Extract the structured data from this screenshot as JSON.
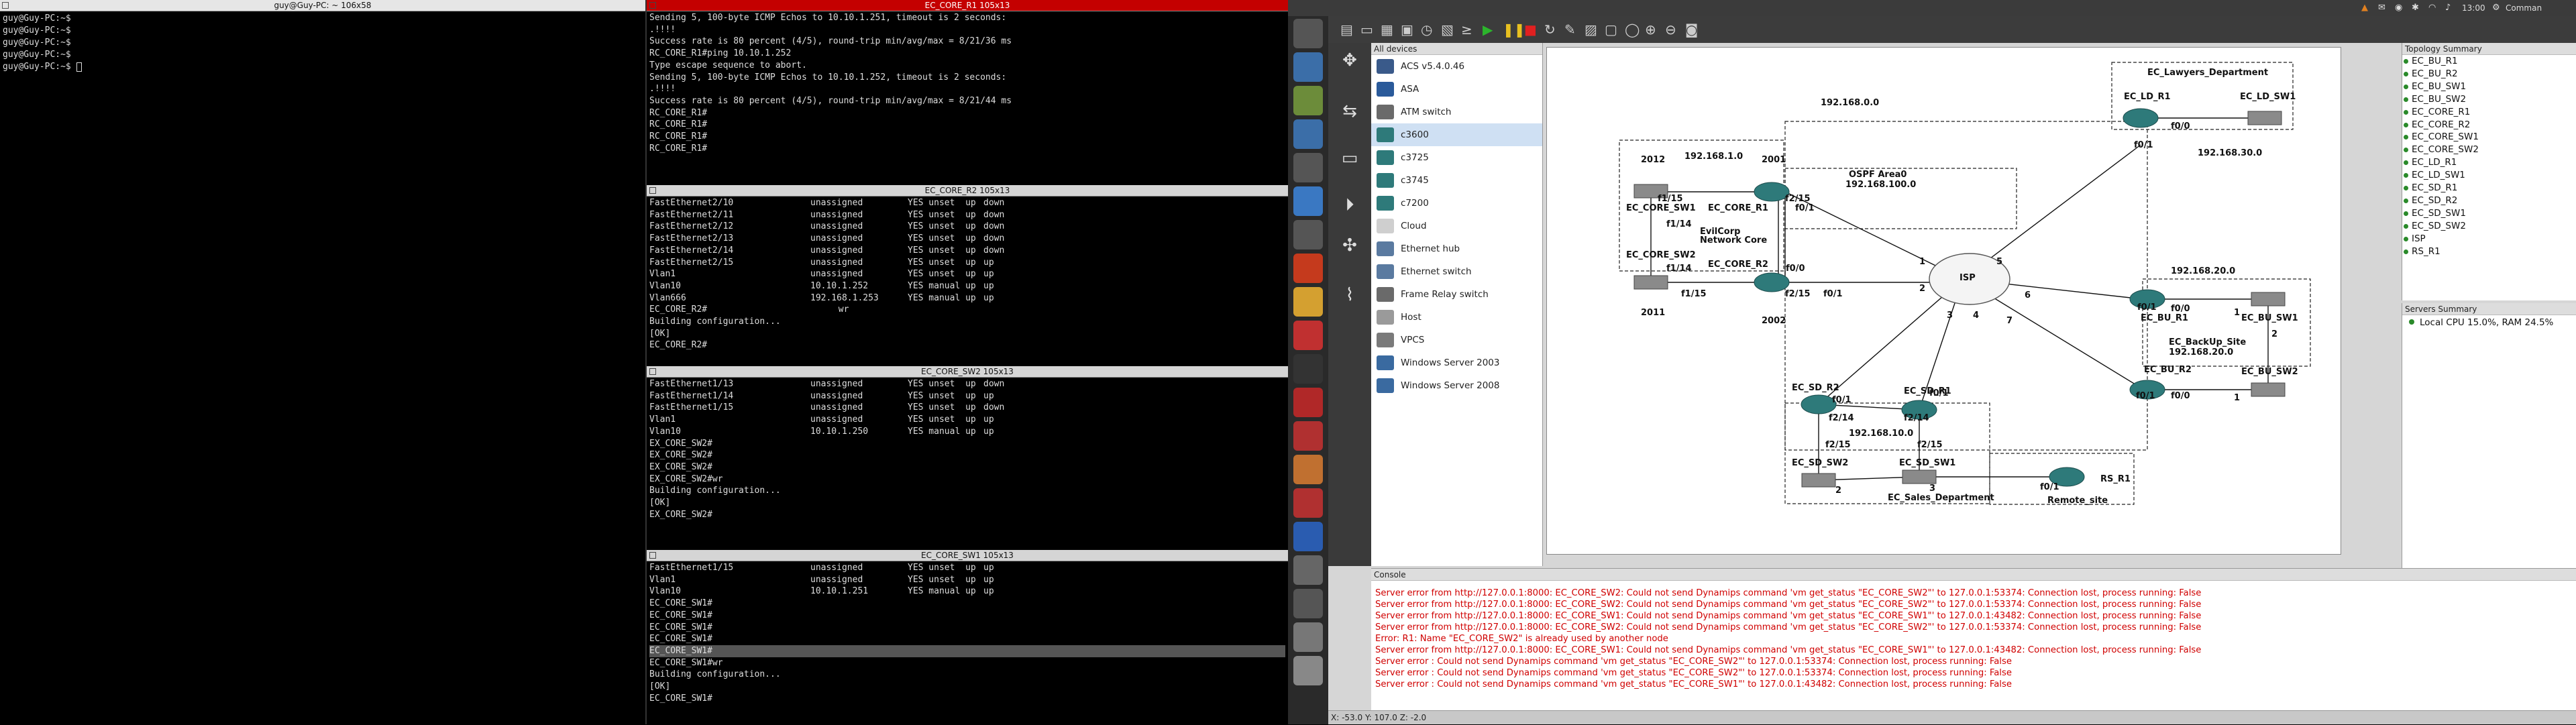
{
  "left_terminal": {
    "title": "guy@Guy-PC: ~ 106x58",
    "lines": [
      "guy@Guy-PC:~$",
      "guy@Guy-PC:~$",
      "guy@Guy-PC:~$",
      "guy@Guy-PC:~$",
      "guy@Guy-PC:~$",
      "guy@Guy-PC:~$ "
    ]
  },
  "term_core_r1": {
    "title": "EC_CORE_R1 105x13",
    "lines": [
      "Sending 5, 100-byte ICMP Echos to 10.10.1.251, timeout is 2 seconds:",
      ".!!!!",
      "Success rate is 80 percent (4/5), round-trip min/avg/max = 8/21/36 ms",
      "RC_CORE_R1#ping 10.10.1.252",
      "",
      "Type escape sequence to abort.",
      "Sending 5, 100-byte ICMP Echos to 10.10.1.252, timeout is 2 seconds:",
      ".!!!!",
      "Success rate is 80 percent (4/5), round-trip min/avg/max = 8/21/44 ms",
      "RC_CORE_R1#",
      "RC_CORE_R1#",
      "RC_CORE_R1#",
      "RC_CORE_R1#"
    ]
  },
  "term_core_r2": {
    "title": "EC_CORE_R2 105x13",
    "rows": [
      [
        "FastEthernet2/10",
        "unassigned",
        "YES unset  up",
        "down"
      ],
      [
        "FastEthernet2/11",
        "unassigned",
        "YES unset  up",
        "down"
      ],
      [
        "FastEthernet2/12",
        "unassigned",
        "YES unset  up",
        "down"
      ],
      [
        "FastEthernet2/13",
        "unassigned",
        "YES unset  up",
        "down"
      ],
      [
        "FastEthernet2/14",
        "unassigned",
        "YES unset  up",
        "down"
      ],
      [
        "FastEthernet2/15",
        "unassigned",
        "YES unset  up",
        "up"
      ],
      [
        "Vlan1",
        "unassigned",
        "YES unset  up",
        "up"
      ],
      [
        "Vlan10",
        "10.10.1.252",
        "YES manual up",
        "up"
      ],
      [
        "Vlan666",
        "192.168.1.253",
        "YES manual up",
        "up"
      ]
    ],
    "tail": [
      "EC_CORE_R2#                         wr",
      "Building configuration...",
      "[OK]",
      "EC_CORE_R2#"
    ]
  },
  "term_core_sw2": {
    "title": "EC_CORE_SW2 105x13",
    "rows": [
      [
        "FastEthernet1/13",
        "unassigned",
        "YES unset  up",
        "down"
      ],
      [
        "FastEthernet1/14",
        "unassigned",
        "YES unset  up",
        "up"
      ],
      [
        "FastEthernet1/15",
        "unassigned",
        "YES unset  up",
        "down"
      ],
      [
        "Vlan1",
        "unassigned",
        "YES unset  up",
        "up"
      ],
      [
        "Vlan10",
        "10.10.1.250",
        "YES manual up",
        "up"
      ]
    ],
    "tail": [
      "EX_CORE_SW2#",
      "EX_CORE_SW2#",
      "EX_CORE_SW2#",
      "EX_CORE_SW2#wr",
      "Building configuration...",
      "[OK]",
      "EX_CORE_SW2#"
    ]
  },
  "term_core_sw1": {
    "title": "EC_CORE_SW1 105x13",
    "rows": [
      [
        "FastEthernet1/15",
        "unassigned",
        "YES unset  up",
        "up"
      ],
      [
        "Vlan1",
        "unassigned",
        "YES unset  up",
        "up"
      ],
      [
        "Vlan10",
        "10.10.1.251",
        "YES manual up",
        "up"
      ]
    ],
    "tail": [
      "EC_CORE_SW1#",
      "EC_CORE_SW1#",
      "EC_CORE_SW1#",
      "EC_CORE_SW1#",
      "EC_CORE_SW1#",
      "EC_CORE_SW1#wr",
      "Building configuration...",
      "[OK]",
      "EC_CORE_SW1#"
    ]
  },
  "gns": {
    "clock": "13:00",
    "user": "Comman",
    "devices_header": "All devices",
    "devices": [
      "ACS v5.4.0.46",
      "ASA",
      "ATM switch",
      "c3600",
      "c3725",
      "c3745",
      "c7200",
      "Cloud",
      "Ethernet hub",
      "Ethernet switch",
      "Frame Relay switch",
      "Host",
      "VPCS",
      "Windows Server 2003",
      "Windows Server 2008"
    ],
    "topology_header": "Topology Summary",
    "topology": [
      "EC_BU_R1",
      "EC_BU_R2",
      "EC_BU_SW1",
      "EC_BU_SW2",
      "EC_CORE_R1",
      "EC_CORE_R2",
      "EC_CORE_SW1",
      "EC_CORE_SW2",
      "EC_LD_R1",
      "EC_LD_SW1",
      "EC_SD_R1",
      "EC_SD_R2",
      "EC_SD_SW1",
      "EC_SD_SW2",
      "ISP",
      "RS_R1"
    ],
    "servers_header": "Servers Summary",
    "server": "Local CPU 15.0%, RAM 24.5%",
    "console_header": "Console",
    "console": [
      "Server error from http://127.0.0.1:8000: EC_CORE_SW2: Could not send Dynamips command 'vm get_status \"EC_CORE_SW2\"' to 127.0.0.1:53374: Connection lost, process running: False",
      "Server error from http://127.0.0.1:8000: EC_CORE_SW2: Could not send Dynamips command 'vm get_status \"EC_CORE_SW2\"' to 127.0.0.1:53374: Connection lost, process running: False",
      "Server error from http://127.0.0.1:8000: EC_CORE_SW1: Could not send Dynamips command 'vm get_status \"EC_CORE_SW1\"' to 127.0.0.1:43482: Connection lost, process running: False",
      "Server error from http://127.0.0.1:8000: EC_CORE_SW2: Could not send Dynamips command 'vm get_status \"EC_CORE_SW2\"' to 127.0.0.1:53374: Connection lost, process running: False",
      "Error: R1: Name \"EC_CORE_SW2\" is already used by another node",
      "Server error from http://127.0.0.1:8000: EC_CORE_SW1: Could not send Dynamips command 'vm get_status \"EC_CORE_SW1\"' to 127.0.0.1:43482: Connection lost, process running: False",
      "Server error : Could not send Dynamips command 'vm get_status \"EC_CORE_SW2\"' to 127.0.0.1:53374: Connection lost, process running: False",
      "Server error : Could not send Dynamips command 'vm get_status \"EC_CORE_SW2\"' to 127.0.0.1:53374: Connection lost, process running: False",
      "Server error : Could not send Dynamips command 'vm get_status \"EC_CORE_SW1\"' to 127.0.0.1:43482: Connection lost, process running: False"
    ],
    "status": "X: -53.0 Y: 107.0 Z: -2.0",
    "canvas_labels": {
      "net_top": "192.168.0.0",
      "lawyers": "EC_Lawyers_Department",
      "ld_r1": "EC_LD_R1",
      "ld_sw1": "EC_LD_SW1",
      "f00_ld": "f0/0",
      "f01_ld": "f0/1",
      "net_ld": "192.168.30.0",
      "n2012": "2012",
      "n2001": "2001",
      "net1": "192.168.1.0",
      "ospf": "OSPF Area0",
      "net100": "192.168.100.0",
      "f115a": "f1/15",
      "core_sw1": "EC_CORE_SW1",
      "core_r1": "EC_CORE_R1",
      "f01a": "f0/1",
      "f114a": "f1/14",
      "evilcorp": "EvilCorp\nNetwork Core",
      "core_sw2": "EC_CORE_SW2",
      "core_r2": "EC_CORE_R2",
      "f114b": "f1/14",
      "f00b": "f0/0",
      "f115b": "f1/15",
      "f215a": "f2/15",
      "f215b": "f2/15",
      "f01b": "f0/1",
      "n2011": "2011",
      "n2002": "2002",
      "isp": "ISP",
      "p1": "1",
      "p2": "2",
      "p3": "3",
      "p4": "4",
      "p5": "5",
      "p6": "6",
      "p7": "7",
      "net20": "192.168.20.0",
      "f01bu": "f0/1",
      "f00bu": "f0/0",
      "bu_r1": "EC_BU_R1",
      "bu_sw1": "EC_BU_SW1",
      "backup": "EC_BackUp_Site",
      "net20b": "192.168.20.0",
      "bu_r2": "EC_BU_R2",
      "bu_sw2": "EC_BU_SW2",
      "f01bu2": "f0/1",
      "f00bu2": "f0/0",
      "one_a": "1",
      "two_a": "2",
      "one_b": "1",
      "sd_r2": "EC_SD_R2",
      "sd_r1": "EC_SD_R1",
      "f01sd": "f0/1",
      "f01sd1": "f0/1",
      "f214a": "f2/14",
      "f214b": "f2/14",
      "net10": "192.168.10.0",
      "f215sd": "f2/15",
      "f215sd2": "f2/15",
      "sd_sw2": "EC_SD_SW2",
      "sd_sw1": "EC_SD_SW1",
      "two_sd": "2",
      "three_sd": "3",
      "sales": "EC_Sales_Department",
      "f01rs": "f0/1",
      "rs_r1": "RS_R1",
      "remote": "Remote_site"
    }
  }
}
